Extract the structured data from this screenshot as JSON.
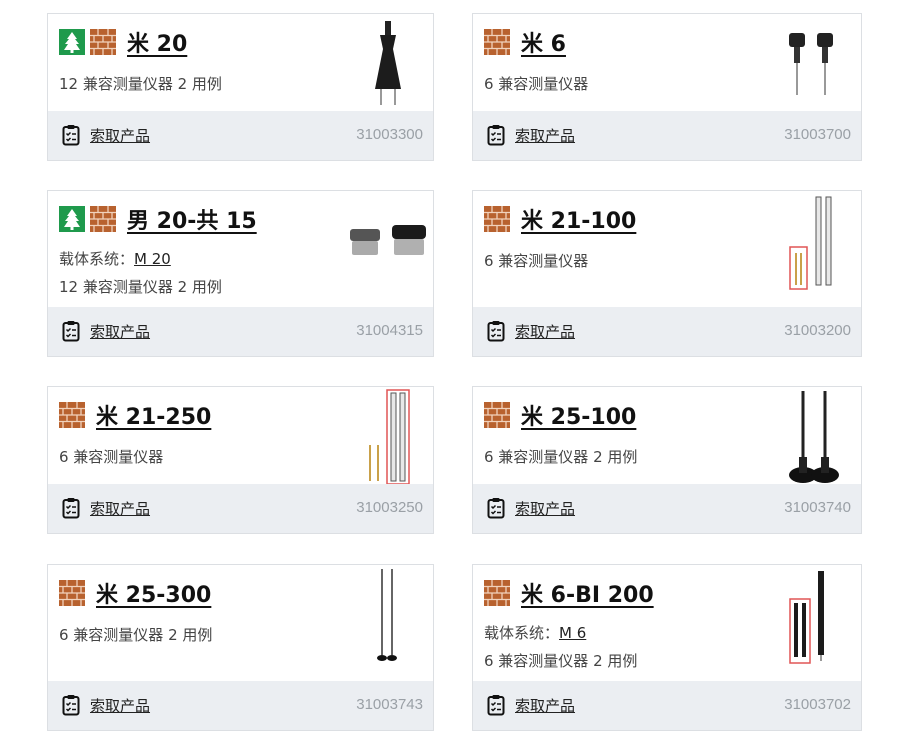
{
  "request_label": "索取产品",
  "carrier_label": "载体系统：",
  "cards": [
    {
      "title": "米 20",
      "line1": "12 兼容测量仪器  2 用例",
      "sku": "31003300",
      "badges": [
        "tree-icon",
        "brick-icon"
      ]
    },
    {
      "title": "米 6",
      "line1": "6 兼容测量仪器",
      "sku": "31003700",
      "badges": [
        "brick-icon"
      ]
    },
    {
      "title": "男 20-共 15",
      "carrier": "M 20",
      "line1": "12 兼容测量仪器  2 用例",
      "sku": "31004315",
      "badges": [
        "tree-icon",
        "brick-icon"
      ]
    },
    {
      "title": "米 21-100",
      "line1": "6 兼容测量仪器",
      "sku": "31003200",
      "badges": [
        "brick-icon"
      ]
    },
    {
      "title": "米 21-250",
      "line1": "6 兼容测量仪器",
      "sku": "31003250",
      "badges": [
        "brick-icon"
      ]
    },
    {
      "title": "米 25-100",
      "line1": "6 兼容测量仪器  2 用例",
      "sku": "31003740",
      "badges": [
        "brick-icon"
      ]
    },
    {
      "title": "米 25-300",
      "line1": "6 兼容测量仪器  2 用例",
      "sku": "31003743",
      "badges": [
        "brick-icon"
      ]
    },
    {
      "title": "米 6-BI 200",
      "carrier": "M 6",
      "line1": "6 兼容测量仪器  2 用例",
      "sku": "31003702",
      "badges": [
        "brick-icon"
      ]
    }
  ]
}
